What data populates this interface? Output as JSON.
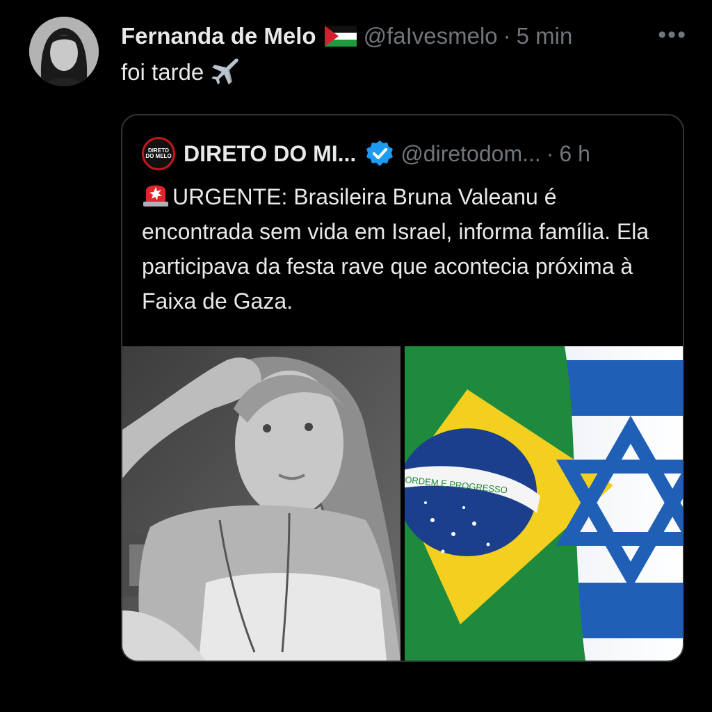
{
  "post": {
    "author_name": "Fernanda de Melo",
    "handle": "@faIvesmelo",
    "separator": "·",
    "time": "5 min",
    "text": "foi tarde",
    "more_icon": "more-horizontal-icon",
    "name_flag_icon": "palestine-flag-icon",
    "text_icon": "airplane-icon"
  },
  "quoted": {
    "logo_line1": "DIRETO",
    "logo_line2": "DO MELO",
    "name": "DIRETO DO MI...",
    "verified_icon": "verified-badge-icon",
    "handle": "@diretodom...",
    "separator": "·",
    "time": "6 h",
    "body_icon": "police-light-icon",
    "body": "URGENTE: Brasileira Bruna Valeanu é encontrada sem vida em Israel, informa família. Ela participava da festa rave que acontecia próxima à Faixa de Gaza.",
    "flag_motto": "ORDEM E PROGRESSO",
    "colors": {
      "verified": "#1d9bf0",
      "siren": "#e0242b"
    }
  }
}
